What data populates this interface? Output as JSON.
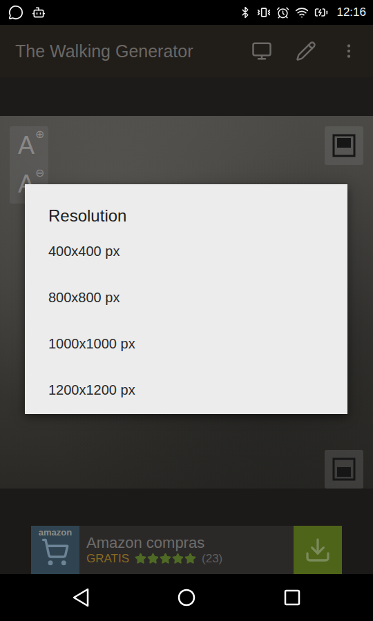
{
  "status_bar": {
    "time": "12:16"
  },
  "app_bar": {
    "title": "The Walking Generator"
  },
  "font_controls": [
    {
      "label": "A",
      "icon": "⊕"
    },
    {
      "label": "A",
      "icon": "⊖"
    }
  ],
  "dialog": {
    "title": "Resolution",
    "options": [
      "400x400 px",
      "800x800 px",
      "1000x1000 px",
      "1200x1200 px"
    ]
  },
  "ad": {
    "brand": "amazon",
    "title": "Amazon compras",
    "badge": "GRATIS",
    "stars": 5,
    "count": "(23)"
  }
}
